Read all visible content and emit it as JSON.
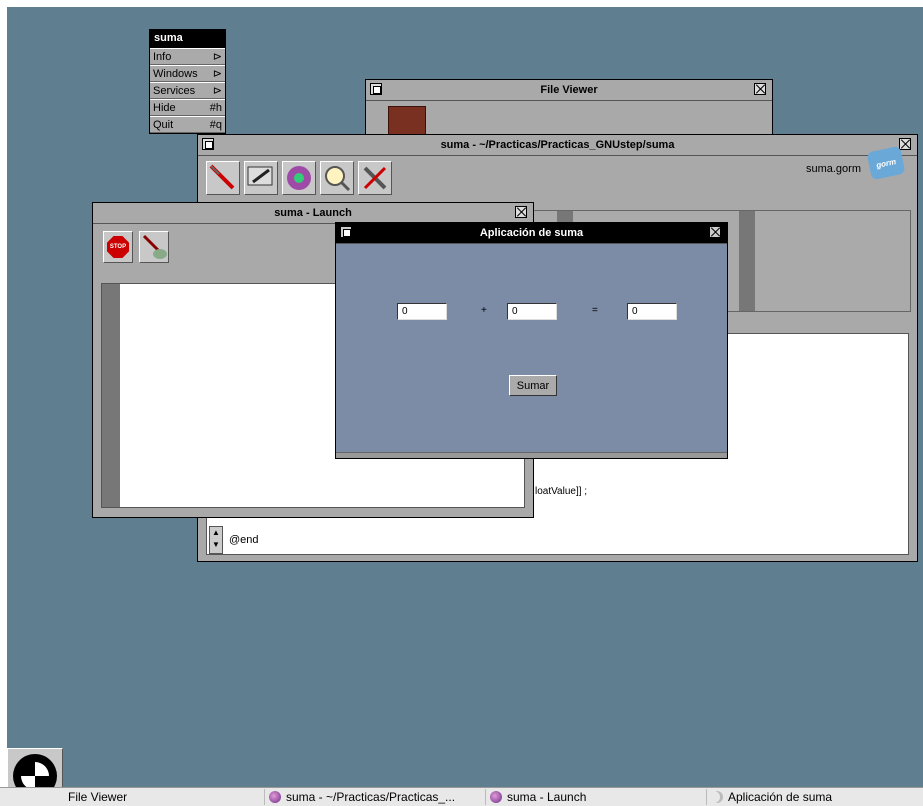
{
  "app_menu": {
    "title": "suma",
    "items": [
      {
        "label": "Info",
        "shortcut": "⊳"
      },
      {
        "label": "Windows",
        "shortcut": "⊳"
      },
      {
        "label": "Services",
        "shortcut": "⊳"
      },
      {
        "label": "Hide",
        "shortcut": "#h"
      },
      {
        "label": "Quit",
        "shortcut": "#q"
      }
    ]
  },
  "file_viewer": {
    "title": "File Viewer"
  },
  "project_window": {
    "title": "suma - ~/Practicas/Practicas_GNUstep/suma",
    "gorm_file": "suma.gorm",
    "gorm_badge": "gorm",
    "code_line_partial": "loatValue]] ;",
    "code_end": "@end"
  },
  "launch_window": {
    "title": "suma - Launch",
    "stop_label": "STOP"
  },
  "app_window": {
    "title": "Aplicación de suma",
    "field_a": "0",
    "plus": "+",
    "field_b": "0",
    "equals": "=",
    "field_result": "0",
    "sumar_button": "Sumar"
  },
  "taskbar": {
    "items": [
      {
        "label": "File Viewer"
      },
      {
        "label": "suma - ~/Practicas/Practicas_..."
      },
      {
        "label": "suma - Launch"
      },
      {
        "label": "Aplicación de suma"
      }
    ]
  },
  "colors": {
    "desktop": "#5f7f91",
    "window": "#aaa9aa",
    "app_bg": "#7c8ba6"
  }
}
